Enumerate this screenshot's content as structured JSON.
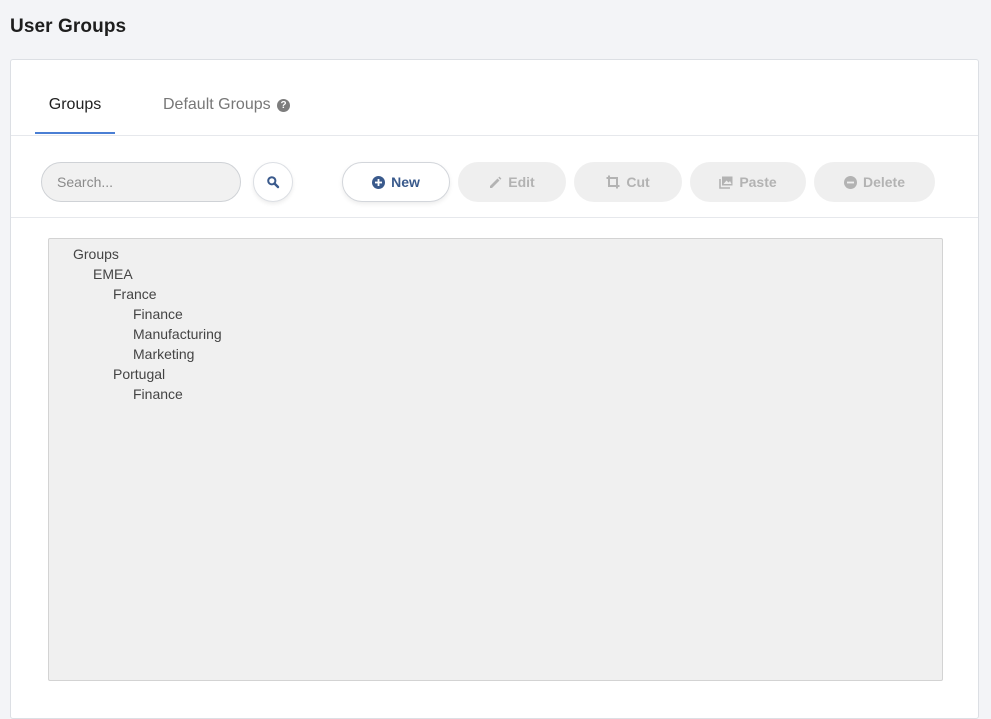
{
  "page": {
    "title": "User Groups"
  },
  "tabs": [
    {
      "label": "Groups",
      "active": true
    },
    {
      "label": "Default Groups",
      "active": false,
      "icon": "help-circle-icon",
      "icon_glyph": "?"
    }
  ],
  "search": {
    "placeholder": "Search...",
    "value": "",
    "button_icon": "search-icon"
  },
  "toolbar": {
    "new_label": "New",
    "new_icon": "plus-circle-icon",
    "edit_label": "Edit",
    "edit_icon": "pencil-icon",
    "cut_label": "Cut",
    "cut_icon": "crop-icon",
    "paste_label": "Paste",
    "paste_icon": "images-icon",
    "delete_label": "Delete",
    "delete_icon": "minus-circle-icon"
  },
  "tree": [
    {
      "label": "Groups",
      "level": 0
    },
    {
      "label": "EMEA",
      "level": 1
    },
    {
      "label": "France",
      "level": 2
    },
    {
      "label": "Finance",
      "level": 3
    },
    {
      "label": "Manufacturing",
      "level": 3
    },
    {
      "label": "Marketing",
      "level": 3
    },
    {
      "label": "Portugal",
      "level": 2
    },
    {
      "label": "Finance",
      "level": 3
    }
  ],
  "colors": {
    "accent": "#4a7fd4",
    "primary_button_text": "#3a5a8c",
    "disabled_text": "#b3b3b3",
    "page_background": "#f3f4f7",
    "tree_background": "#f0f0f0"
  }
}
